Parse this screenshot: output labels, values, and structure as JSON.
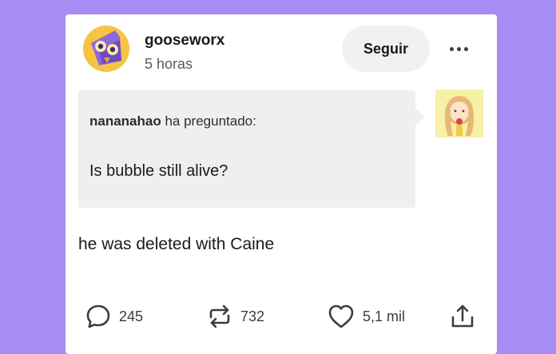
{
  "post": {
    "author": "gooseworx",
    "time": "5 horas",
    "follow_label": "Seguir",
    "ask": {
      "asker": "nananahao",
      "asked_text": " ha preguntado:",
      "question": "Is bubble still alive?"
    },
    "answer": "he was deleted with Caine",
    "stats": {
      "comments": "245",
      "reblogs": "732",
      "likes": "5,1 mil"
    }
  },
  "colors": {
    "background": "#a88cf5",
    "card": "#ffffff",
    "ask_bubble": "#efeff0",
    "icon": "#3a3d46"
  },
  "icons": [
    "comment-icon",
    "reblog-icon",
    "heart-icon",
    "share-icon",
    "more-icon"
  ]
}
